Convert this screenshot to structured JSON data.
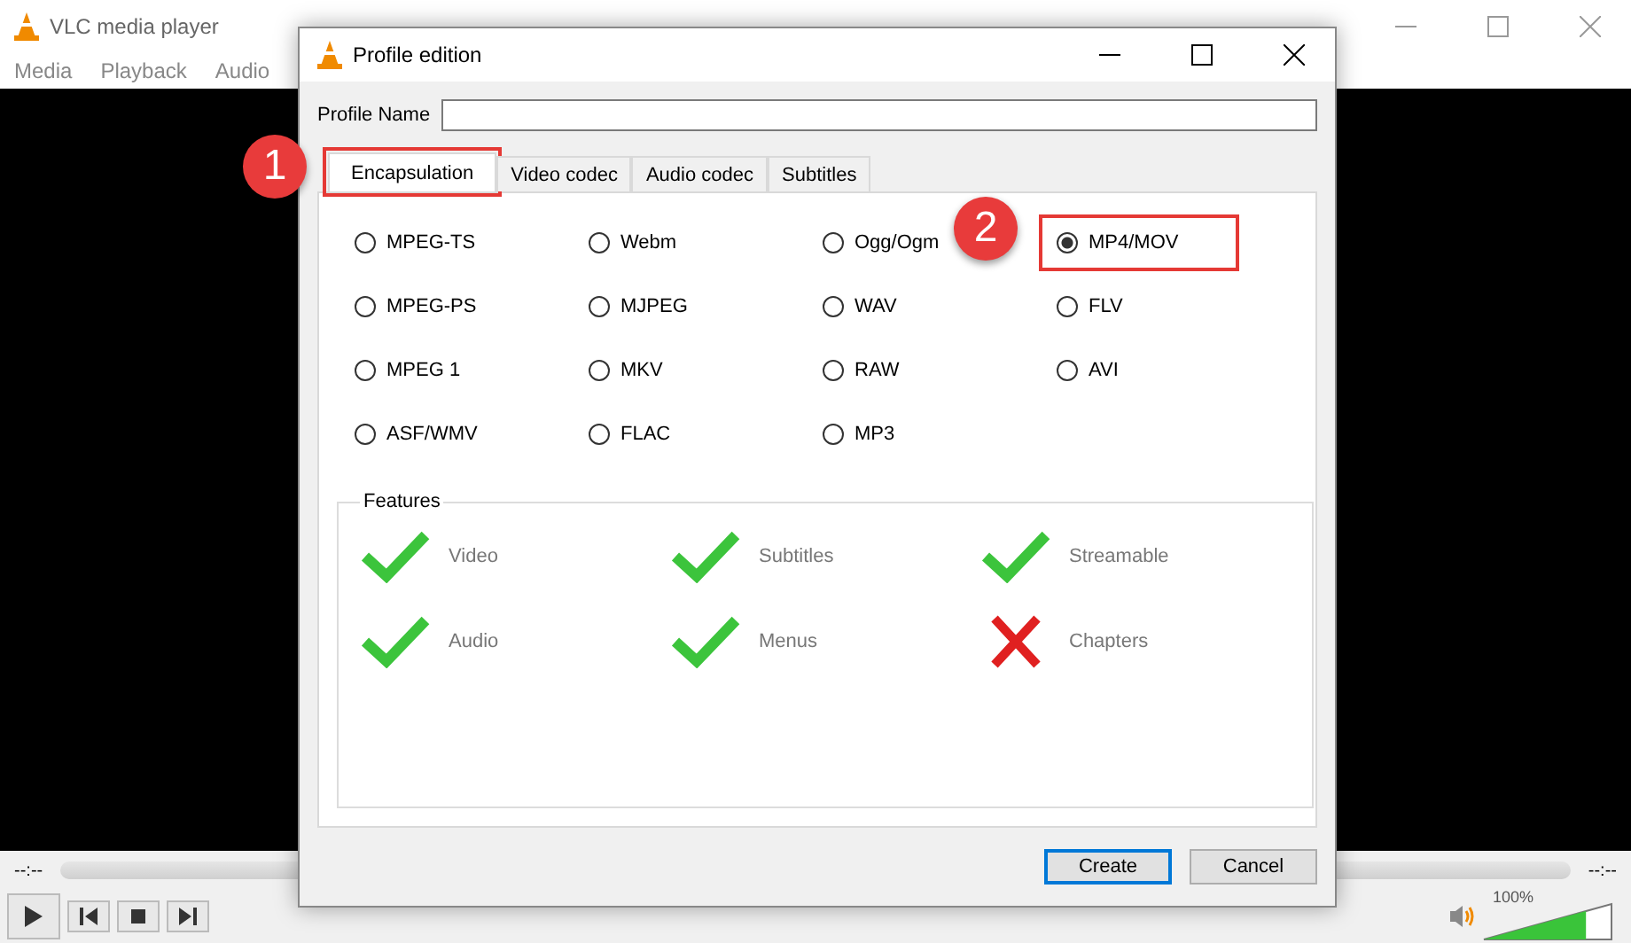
{
  "main_window": {
    "title": "VLC media player",
    "menu": [
      "Media",
      "Playback",
      "Audio"
    ],
    "elapsed": "--:--",
    "remaining": "--:--",
    "volume": {
      "reading": "100%",
      "level": 0.8
    }
  },
  "dialog": {
    "title": "Profile edition",
    "profile_name": {
      "label": "Profile Name"
    },
    "tabs": [
      {
        "label": "Encapsulation",
        "selected": true,
        "highlighted": true,
        "callout": "1"
      },
      {
        "label": "Video codec",
        "selected": false,
        "highlighted": false
      },
      {
        "label": "Audio codec",
        "selected": false,
        "highlighted": false
      },
      {
        "label": "Subtitles",
        "selected": false,
        "highlighted": false
      }
    ],
    "formats": [
      {
        "label": "MPEG-TS",
        "selected": false
      },
      {
        "label": "Webm",
        "selected": false
      },
      {
        "label": "Ogg/Ogm",
        "selected": false
      },
      {
        "label": "MP4/MOV",
        "selected": true,
        "highlighted": true,
        "callout": "2"
      },
      {
        "label": "MPEG-PS",
        "selected": false
      },
      {
        "label": "MJPEG",
        "selected": false
      },
      {
        "label": "WAV",
        "selected": false
      },
      {
        "label": "FLV",
        "selected": false
      },
      {
        "label": "MPEG 1",
        "selected": false
      },
      {
        "label": "MKV",
        "selected": false
      },
      {
        "label": "RAW",
        "selected": false
      },
      {
        "label": "AVI",
        "selected": false
      },
      {
        "label": "ASF/WMV",
        "selected": false
      },
      {
        "label": "FLAC",
        "selected": false
      },
      {
        "label": "MP3",
        "selected": false
      }
    ],
    "features": {
      "title": "Features",
      "items": [
        {
          "label": "Video",
          "supported": true
        },
        {
          "label": "Subtitles",
          "supported": true
        },
        {
          "label": "Streamable",
          "supported": true
        },
        {
          "label": "Audio",
          "supported": true
        },
        {
          "label": "Menus",
          "supported": true
        },
        {
          "label": "Chapters",
          "supported": false
        }
      ]
    },
    "buttons": [
      {
        "label": "Create",
        "default": true
      },
      {
        "label": "Cancel",
        "default": false
      }
    ]
  }
}
